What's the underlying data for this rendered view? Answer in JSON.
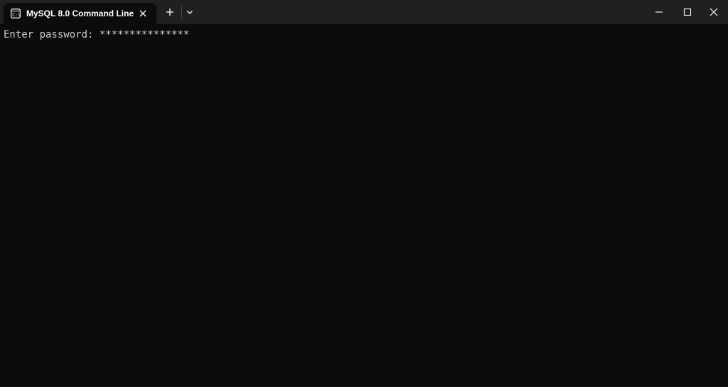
{
  "window": {
    "tab_title": "MySQL 8.0 Command Line Client",
    "icons": {
      "tab": "console-icon",
      "tab_close": "close-icon",
      "new_tab": "plus-icon",
      "dropdown": "chevron-down-icon",
      "minimize": "minimize-icon",
      "maximize": "maximize-icon",
      "close": "close-icon"
    }
  },
  "console": {
    "prompt": "Enter password: ",
    "masked_input": "***************",
    "text_color": "#cccccc",
    "background_color": "#0c0c0c"
  }
}
